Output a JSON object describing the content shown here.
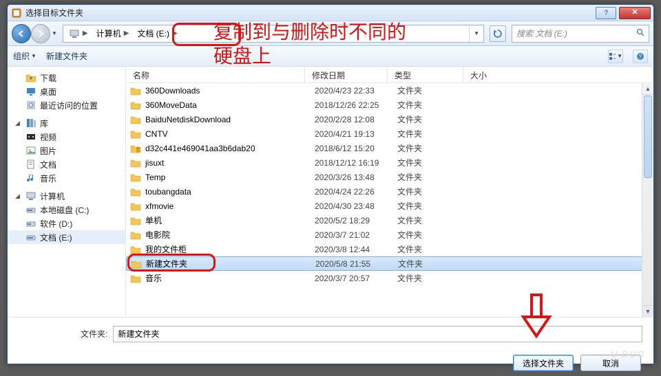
{
  "window": {
    "title": "选择目标文件夹"
  },
  "breadcrumb": {
    "root": "计算机",
    "drive": "文档 (E:)"
  },
  "search": {
    "placeholder": "搜索 文档 (E:)"
  },
  "toolbar": {
    "organize": "组织",
    "new_folder": "新建文件夹"
  },
  "tree": {
    "downloads": "下载",
    "desktop": "桌面",
    "recent": "最近访问的位置",
    "libraries": "库",
    "videos": "视频",
    "pictures": "图片",
    "documents": "文档",
    "music": "音乐",
    "computer": "计算机",
    "drive_c": "本地磁盘 (C:)",
    "drive_d": "软件 (D:)",
    "drive_e": "文档 (E:)"
  },
  "columns": {
    "name": "名称",
    "date": "修改日期",
    "type": "类型",
    "size": "大小"
  },
  "type_folder": "文件夹",
  "rows": [
    {
      "name": "360Downloads",
      "date": "2020/4/23 22:33"
    },
    {
      "name": "360MoveData",
      "date": "2018/12/26 22:25"
    },
    {
      "name": "BaiduNetdiskDownload",
      "date": "2020/2/28 12:08"
    },
    {
      "name": "CNTV",
      "date": "2020/4/21 19:13"
    },
    {
      "name": "d32c441e469041aa3b6dab20",
      "date": "2018/6/12 15:20"
    },
    {
      "name": "jisuxt",
      "date": "2018/12/12 16:19"
    },
    {
      "name": "Temp",
      "date": "2020/3/26 13:48"
    },
    {
      "name": "toubangdata",
      "date": "2020/4/24 22:26"
    },
    {
      "name": "xfmovie",
      "date": "2020/4/30 23:48"
    },
    {
      "name": "单机",
      "date": "2020/5/2 18:29"
    },
    {
      "name": "电影院",
      "date": "2020/3/7 21:02"
    },
    {
      "name": "我的文件柜",
      "date": "2020/3/8 12:44"
    },
    {
      "name": "新建文件夹",
      "date": "2020/5/8 21:55"
    },
    {
      "name": "音乐",
      "date": "2020/3/7 20:57"
    }
  ],
  "selected_index": 12,
  "locked_index": 4,
  "footer": {
    "label": "文件夹:",
    "value": "新建文件夹"
  },
  "buttons": {
    "select": "选择文件夹",
    "cancel": "取消"
  },
  "annotations": {
    "line1": "复制到与删除时不同的",
    "line2": "硬盘上"
  },
  "watermark": "U BUG"
}
